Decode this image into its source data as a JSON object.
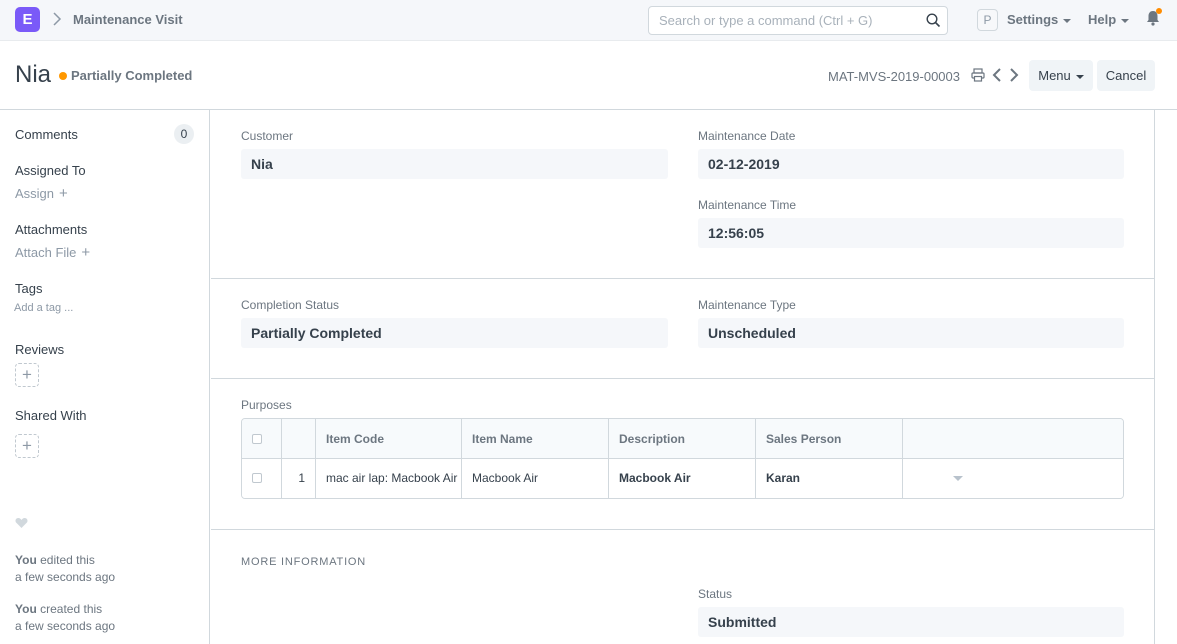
{
  "navbar": {
    "logo_letter": "E",
    "breadcrumb": "Maintenance Visit",
    "search_placeholder": "Search or type a command (Ctrl + G)",
    "avatar_letter": "P",
    "settings_label": "Settings",
    "help_label": "Help"
  },
  "header": {
    "title": "Nia",
    "status": "Partially Completed",
    "status_color": "#ff9800",
    "doc_id": "MAT-MVS-2019-00003",
    "menu_label": "Menu",
    "cancel_label": "Cancel"
  },
  "sidebar": {
    "comments_label": "Comments",
    "comments_count": "0",
    "assigned_to_label": "Assigned To",
    "assign_label": "Assign",
    "attachments_label": "Attachments",
    "attach_file_label": "Attach File",
    "tags_label": "Tags",
    "add_tag_label": "Add a tag ...",
    "reviews_label": "Reviews",
    "shared_with_label": "Shared With",
    "timeline": [
      {
        "user": "You",
        "action": "edited this",
        "time": "a few seconds ago"
      },
      {
        "user": "You",
        "action": "created this",
        "time": "a few seconds ago"
      }
    ]
  },
  "form": {
    "customer_label": "Customer",
    "customer_value": "Nia",
    "maintenance_date_label": "Maintenance Date",
    "maintenance_date_value": "02-12-2019",
    "maintenance_time_label": "Maintenance Time",
    "maintenance_time_value": "12:56:05",
    "completion_status_label": "Completion Status",
    "completion_status_value": "Partially Completed",
    "maintenance_type_label": "Maintenance Type",
    "maintenance_type_value": "Unscheduled",
    "purposes_label": "Purposes",
    "more_info_label": "MORE INFORMATION",
    "status_label": "Status",
    "status_value": "Submitted"
  },
  "purposes_table": {
    "columns": [
      "Item Code",
      "Item Name",
      "Description",
      "Sales Person"
    ],
    "rows": [
      {
        "idx": "1",
        "item_code": "mac air lap: Macbook Air",
        "item_name": "Macbook Air",
        "description": "Macbook Air",
        "sales_person": "Karan"
      }
    ]
  }
}
